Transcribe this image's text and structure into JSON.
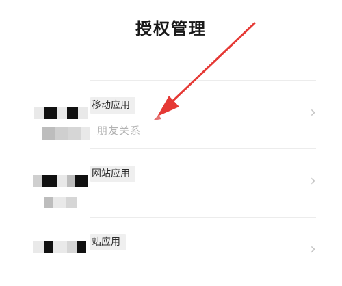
{
  "header": {
    "title": "授权管理"
  },
  "apps": [
    {
      "type_label": "移动应用",
      "subtitle": "朋友关系"
    },
    {
      "type_label": "网站应用",
      "subtitle": ""
    },
    {
      "type_label": "站应用",
      "subtitle": ""
    }
  ],
  "icons": {
    "chevron": "chevron-right-icon",
    "annotation": "red-arrow-icon"
  },
  "colors": {
    "annotation_arrow": "#e53935",
    "background": "#ffffff"
  }
}
